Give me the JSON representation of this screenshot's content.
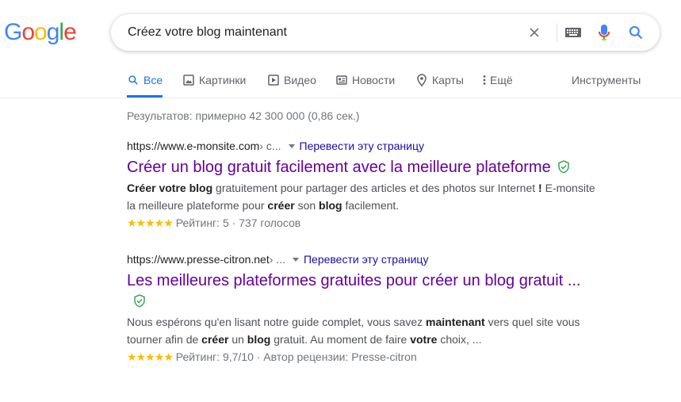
{
  "logo": {
    "letters": [
      "G",
      "o",
      "o",
      "g",
      "l",
      "e"
    ],
    "colors": [
      "#4285F4",
      "#EA4335",
      "#FBBC05",
      "#4285F4",
      "#34A853",
      "#EA4335"
    ]
  },
  "search": {
    "query": "Créez votre blog maintenant"
  },
  "tabs": [
    {
      "label": "Все",
      "icon": "search-icon"
    },
    {
      "label": "Картинки",
      "icon": "image-icon"
    },
    {
      "label": "Видео",
      "icon": "video-icon"
    },
    {
      "label": "Новости",
      "icon": "news-icon"
    },
    {
      "label": "Карты",
      "icon": "map-pin-icon"
    },
    {
      "label": "Ещё",
      "icon": "more-vert-icon"
    }
  ],
  "tools_label": "Инструменты",
  "stats": "Результатов: примерно 42 300 000 (0,86 сек.)",
  "results": [
    {
      "url": "https://www.e-monsite.com",
      "crumb": " › c...",
      "translate": "Перевести эту страницу",
      "title": "Créer un blog gratuit facilement avec la meilleure plateforme",
      "snippet": [
        {
          "b": true,
          "t": "Créer votre blog"
        },
        {
          "b": false,
          "t": " gratuitement pour partager des articles et des photos sur Internet "
        },
        {
          "b": true,
          "t": "!"
        },
        {
          "b": false,
          "t": " E-monsite la meilleure plateforme pour "
        },
        {
          "b": true,
          "t": "créer"
        },
        {
          "b": false,
          "t": " son "
        },
        {
          "b": true,
          "t": "blog"
        },
        {
          "b": false,
          "t": " facilement."
        }
      ],
      "stars": "★★★★★",
      "rating": "Рейтинг: 5 · 737 голосов"
    },
    {
      "url": "https://www.presse-citron.net",
      "crumb": " › ...",
      "translate": "Перевести эту страницу",
      "title": "Les meilleures plateformes gratuites pour créer un blog gratuit ...",
      "snippet": [
        {
          "b": false,
          "t": "Nous espérons qu'en lisant notre guide complet, vous savez "
        },
        {
          "b": true,
          "t": "maintenant"
        },
        {
          "b": false,
          "t": " vers quel site vous tourner afin de "
        },
        {
          "b": true,
          "t": "créer"
        },
        {
          "b": false,
          "t": " un "
        },
        {
          "b": true,
          "t": "blog"
        },
        {
          "b": false,
          "t": " gratuit. Au moment de faire "
        },
        {
          "b": true,
          "t": "votre"
        },
        {
          "b": false,
          "t": " choix, ..."
        }
      ],
      "stars": "★★★★★",
      "rating": "Рейтинг: 9,7/10 · Автор рецензии: Presse-citron"
    }
  ]
}
